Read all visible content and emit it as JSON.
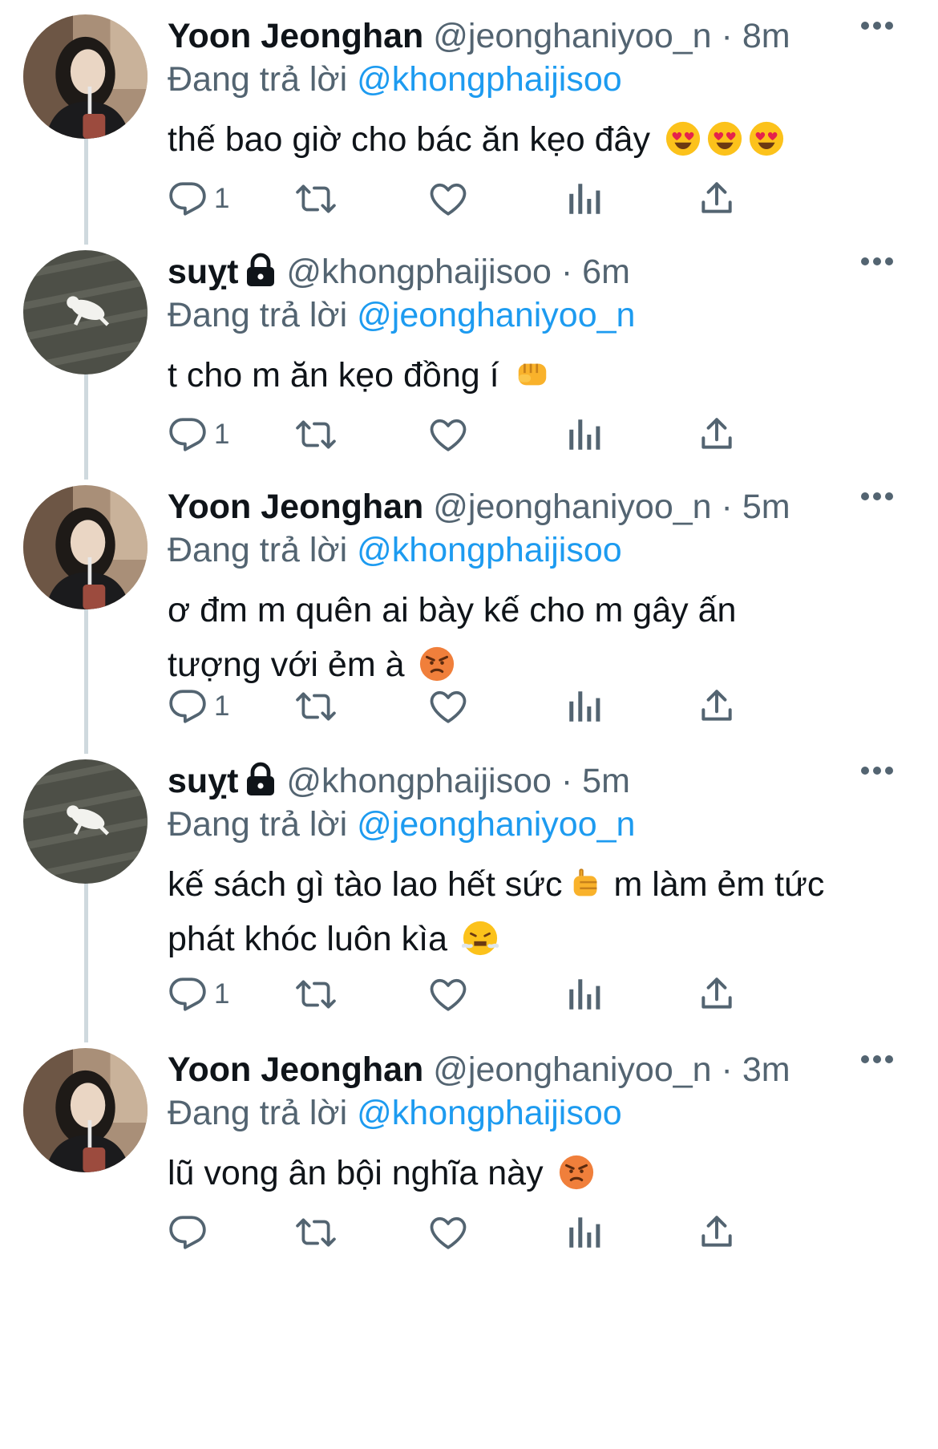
{
  "colors": {
    "accent": "#1d9bf0",
    "secondary_text": "#536471",
    "primary_text": "#0f1419",
    "thread_line": "#cfd9de"
  },
  "tweets": [
    {
      "name": "Yoon Jeonghan",
      "handle": "@jeonghaniyoo_n",
      "sep": "·",
      "time": "8m",
      "locked": false,
      "replying_prefix": "Đang trả lời",
      "replying_to": "@khongphaijisoo",
      "text": "thế bao giờ cho bác ăn kẹo đây",
      "emoji": [
        "heart-eyes-emoji",
        "heart-eyes-emoji",
        "heart-eyes-emoji"
      ],
      "reply_count": "1",
      "avatar": "girl-photo-avatar"
    },
    {
      "name": "suỵt",
      "handle": "@khongphaijisoo",
      "sep": "·",
      "time": "6m",
      "locked": true,
      "replying_prefix": "Đang trả lời",
      "replying_to": "@jeonghaniyoo_n",
      "text": "t cho m ăn kẹo đồng í",
      "emoji": [
        "fist-emoji"
      ],
      "reply_count": "1",
      "avatar": "cat-on-floor-avatar"
    },
    {
      "name": "Yoon Jeonghan",
      "handle": "@jeonghaniyoo_n",
      "sep": "·",
      "time": "5m",
      "locked": false,
      "replying_prefix": "Đang trả lời",
      "replying_to": "@khongphaijisoo",
      "text_lines": [
        "ơ đm m quên ai bày kế cho m gây ấn",
        "tượng với ẻm à"
      ],
      "emoji": [
        "angry-face-emoji"
      ],
      "reply_count": "1",
      "avatar": "girl-photo-avatar"
    },
    {
      "name": "suỵt",
      "handle": "@khongphaijisoo",
      "sep": "·",
      "time": "5m",
      "locked": true,
      "replying_prefix": "Đang trả lời",
      "replying_to": "@jeonghaniyoo_n",
      "text_part1": "kế sách gì tào lao hết sức",
      "text_part2": "m làm ẻm tức",
      "text_line2": "phát khóc luôn kìa",
      "emoji": [
        "thumbs-hand-emoji",
        "steam-face-emoji"
      ],
      "reply_count": "1",
      "avatar": "cat-on-floor-avatar"
    },
    {
      "name": "Yoon Jeonghan",
      "handle": "@jeonghaniyoo_n",
      "sep": "·",
      "time": "3m",
      "locked": false,
      "replying_prefix": "Đang trả lời",
      "replying_to": "@khongphaijisoo",
      "text": "lũ vong ân bội nghĩa này",
      "emoji": [
        "angry-face-emoji"
      ],
      "reply_count": "",
      "avatar": "girl-photo-avatar"
    }
  ]
}
